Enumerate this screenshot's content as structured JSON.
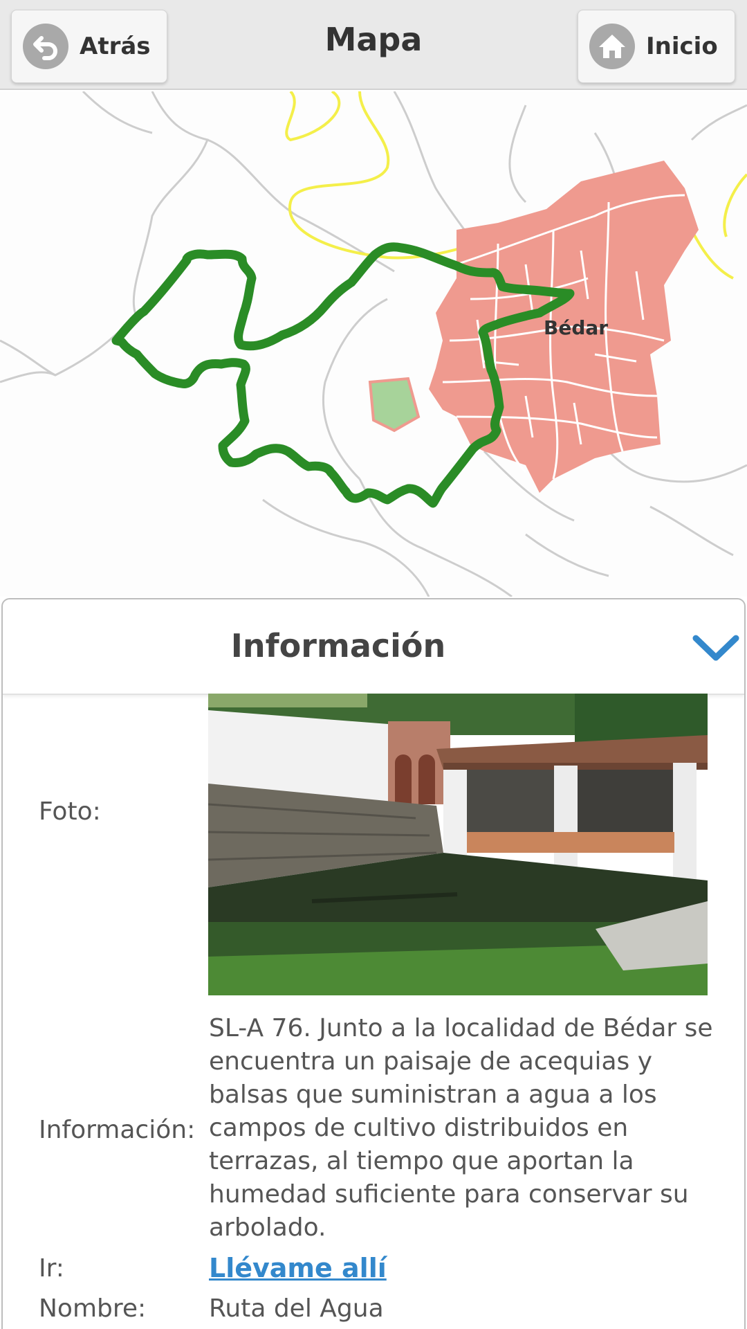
{
  "header": {
    "back_label": "Atrás",
    "title": "Mapa",
    "home_label": "Inicio"
  },
  "map": {
    "place_label": "Bédar",
    "route_color": "#2a8c26",
    "town_color": "#ef9a8f",
    "road_color": "#f4ef4a"
  },
  "panel": {
    "title": "Información",
    "accent": "#3388cc",
    "fields": {
      "foto_label": "Foto:",
      "info_label": "Información:",
      "info_text": "SL-A 76. Junto a la localidad de Bédar se encuentra un paisaje de acequias y balsas que suministran a agua a los campos de cultivo distribuidos en terrazas, al tiempo que aportan la humedad suficiente para conservar su arbolado.",
      "ir_label": "Ir:",
      "ir_link": "Llévame allí",
      "nombre_label": "Nombre:",
      "nombre_value": "Ruta del Agua"
    }
  }
}
